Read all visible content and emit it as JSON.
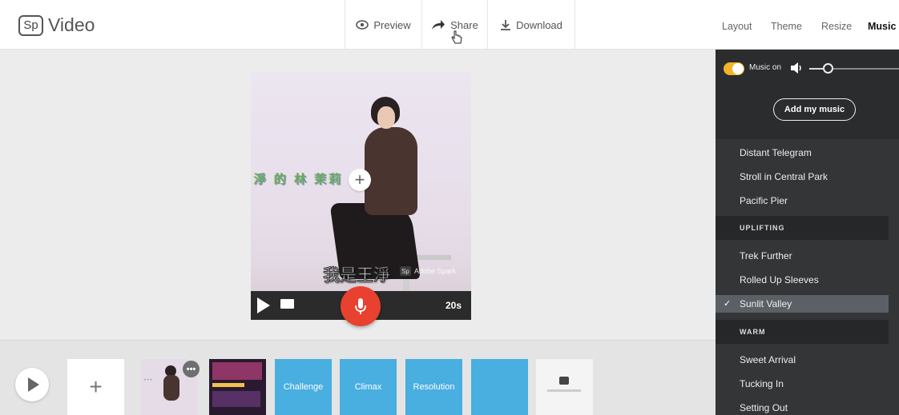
{
  "app": {
    "logo_mark": "Sp",
    "name": "Video"
  },
  "header": {
    "preview_label": "Preview",
    "share_label": "Share",
    "download_label": "Download",
    "nav": [
      "Layout",
      "Theme",
      "Resize",
      "Music"
    ],
    "active_nav": "Music"
  },
  "canvas": {
    "deco_text": "淨 的 林 茉莉",
    "subtitle": "我是王淨",
    "watermark_mark": "Sp",
    "watermark_text": "Adobe Spark",
    "duration": "20s"
  },
  "filmstrip": {
    "add_label": "+",
    "more_label": "•••",
    "slides": [
      "Challenge",
      "Climax",
      "Resolution",
      ""
    ]
  },
  "music": {
    "toggle_label": "Music on",
    "add_button": "Add my music",
    "tracks_top": [
      "Distant Telegram",
      "Stroll in Central Park",
      "Pacific Pier"
    ],
    "uplifting_header": "UPLIFTING",
    "tracks_uplifting": [
      "Trek Further",
      "Rolled Up Sleeves",
      "Sunlit Valley"
    ],
    "selected_track": "Sunlit Valley",
    "warm_header": "WARM",
    "tracks_warm": [
      "Sweet Arrival",
      "Tucking In",
      "Setting Out"
    ]
  },
  "colors": {
    "accent_toggle": "#f0b429",
    "mic_red": "#e8412f",
    "slide_blue": "#49aee0",
    "panel_dark": "#333537"
  }
}
